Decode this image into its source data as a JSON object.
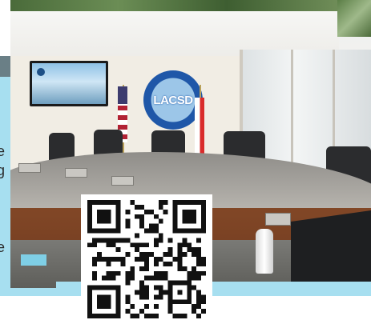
{
  "photo": {
    "seal_text": "LACSD",
    "side_text_fragments": [
      "he",
      "ng",
      "ue",
      "e."
    ]
  },
  "qr": {
    "icon": "qr-code-icon"
  },
  "colors": {
    "accent_cyan": "#a7dff0",
    "wood": "#7a4224",
    "seal_blue": "#1f57a8"
  }
}
